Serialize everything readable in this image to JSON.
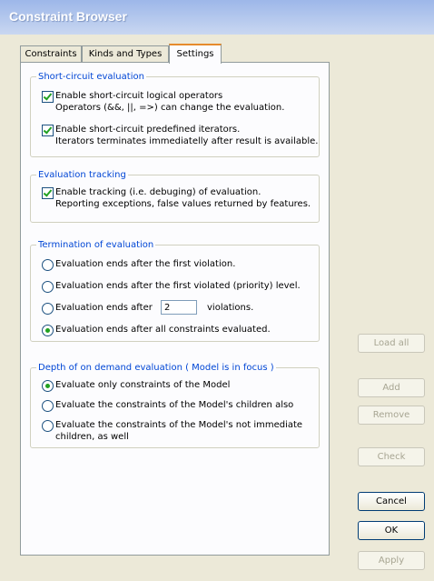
{
  "window": {
    "title": "Constraint Browser"
  },
  "tabs": [
    {
      "label": "Constraints",
      "active": false
    },
    {
      "label": "Kinds and Types",
      "active": false
    },
    {
      "label": "Settings",
      "active": true
    }
  ],
  "settings": {
    "short_circuit": {
      "title": "Short-circuit evaluation",
      "logical_ops": {
        "label": "Enable short-circuit logical operators",
        "description": "Operators (&&, ||, =>) can change the evaluation.",
        "checked": true
      },
      "predefined_iterators": {
        "label": "Enable short-circuit predefined iterators.",
        "description": "Iterators terminates immediatelly after result is available.",
        "checked": true
      }
    },
    "tracking": {
      "title": "Evaluation tracking",
      "enable_tracking": {
        "label": "Enable tracking (i.e. debuging) of evaluation.",
        "description": "Reporting exceptions, false values returned by features.",
        "checked": true
      }
    },
    "termination": {
      "title": "Termination of evaluation",
      "opt_first_violation": "Evaluation ends after the first violation.",
      "opt_first_violated_level": "Evaluation ends after the first violated (priority) level.",
      "opt_after_n_prefix": "Evaluation ends after",
      "opt_after_n_value": "2",
      "opt_after_n_suffix": "violations.",
      "opt_all_constraints": "Evaluation ends after all constraints evaluated.",
      "selected": "all_constraints"
    },
    "depth": {
      "title": "Depth of on demand evaluation ( Model is in focus )",
      "opt_only_model": "Evaluate only constraints of the Model",
      "opt_children": "Evaluate the constraints of the Model's children also",
      "opt_not_immediate_line1": "Evaluate the constraints of the Model's not immediate",
      "opt_not_immediate_line2": "children, as well",
      "selected": "only_model"
    }
  },
  "buttons": {
    "load_all": "Load all",
    "add": "Add",
    "remove": "Remove",
    "check": "Check",
    "cancel": "Cancel",
    "ok": "OK",
    "apply": "Apply"
  }
}
